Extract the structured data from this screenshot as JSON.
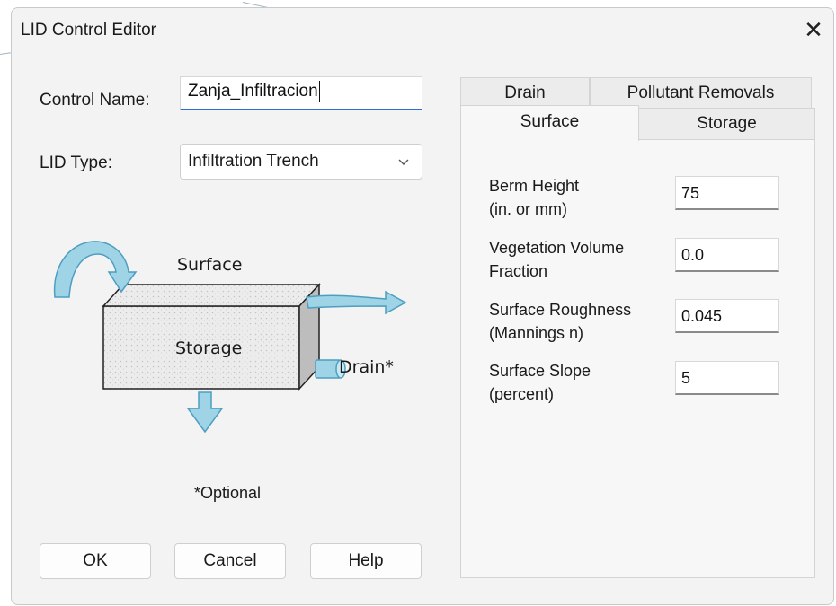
{
  "dialog": {
    "title": "LID Control Editor",
    "close_glyph": "✕"
  },
  "control_name": {
    "label": "Control Name:",
    "value": "Zanja_Infiltracion"
  },
  "lid_type": {
    "label": "LID Type:",
    "selected": "Infiltration Trench"
  },
  "illustration": {
    "surface_label": "Surface",
    "storage_label": "Storage",
    "drain_label": "Drain*",
    "optional_note": "*Optional"
  },
  "buttons": {
    "ok": "OK",
    "cancel": "Cancel",
    "help": "Help"
  },
  "tabs": {
    "drain": "Drain",
    "pollutant_removals": "Pollutant Removals",
    "surface": "Surface",
    "storage": "Storage",
    "active": "Surface"
  },
  "surface_fields": [
    {
      "label_line1": "Berm Height",
      "label_line2": "(in. or mm)",
      "value": "75"
    },
    {
      "label_line1": "Vegetation Volume",
      "label_line2": "Fraction",
      "value": "0.0"
    },
    {
      "label_line1": "Surface Roughness",
      "label_line2": "(Mannings n)",
      "value": "0.045"
    },
    {
      "label_line1": "Surface Slope",
      "label_line2": "(percent)",
      "value": "5"
    }
  ],
  "colors": {
    "dialog_bg": "#f3f3f3",
    "focus_accent": "#2a6fd1",
    "arrow_fill": "#9fd3e6",
    "arrow_stroke": "#4d9ec0"
  }
}
